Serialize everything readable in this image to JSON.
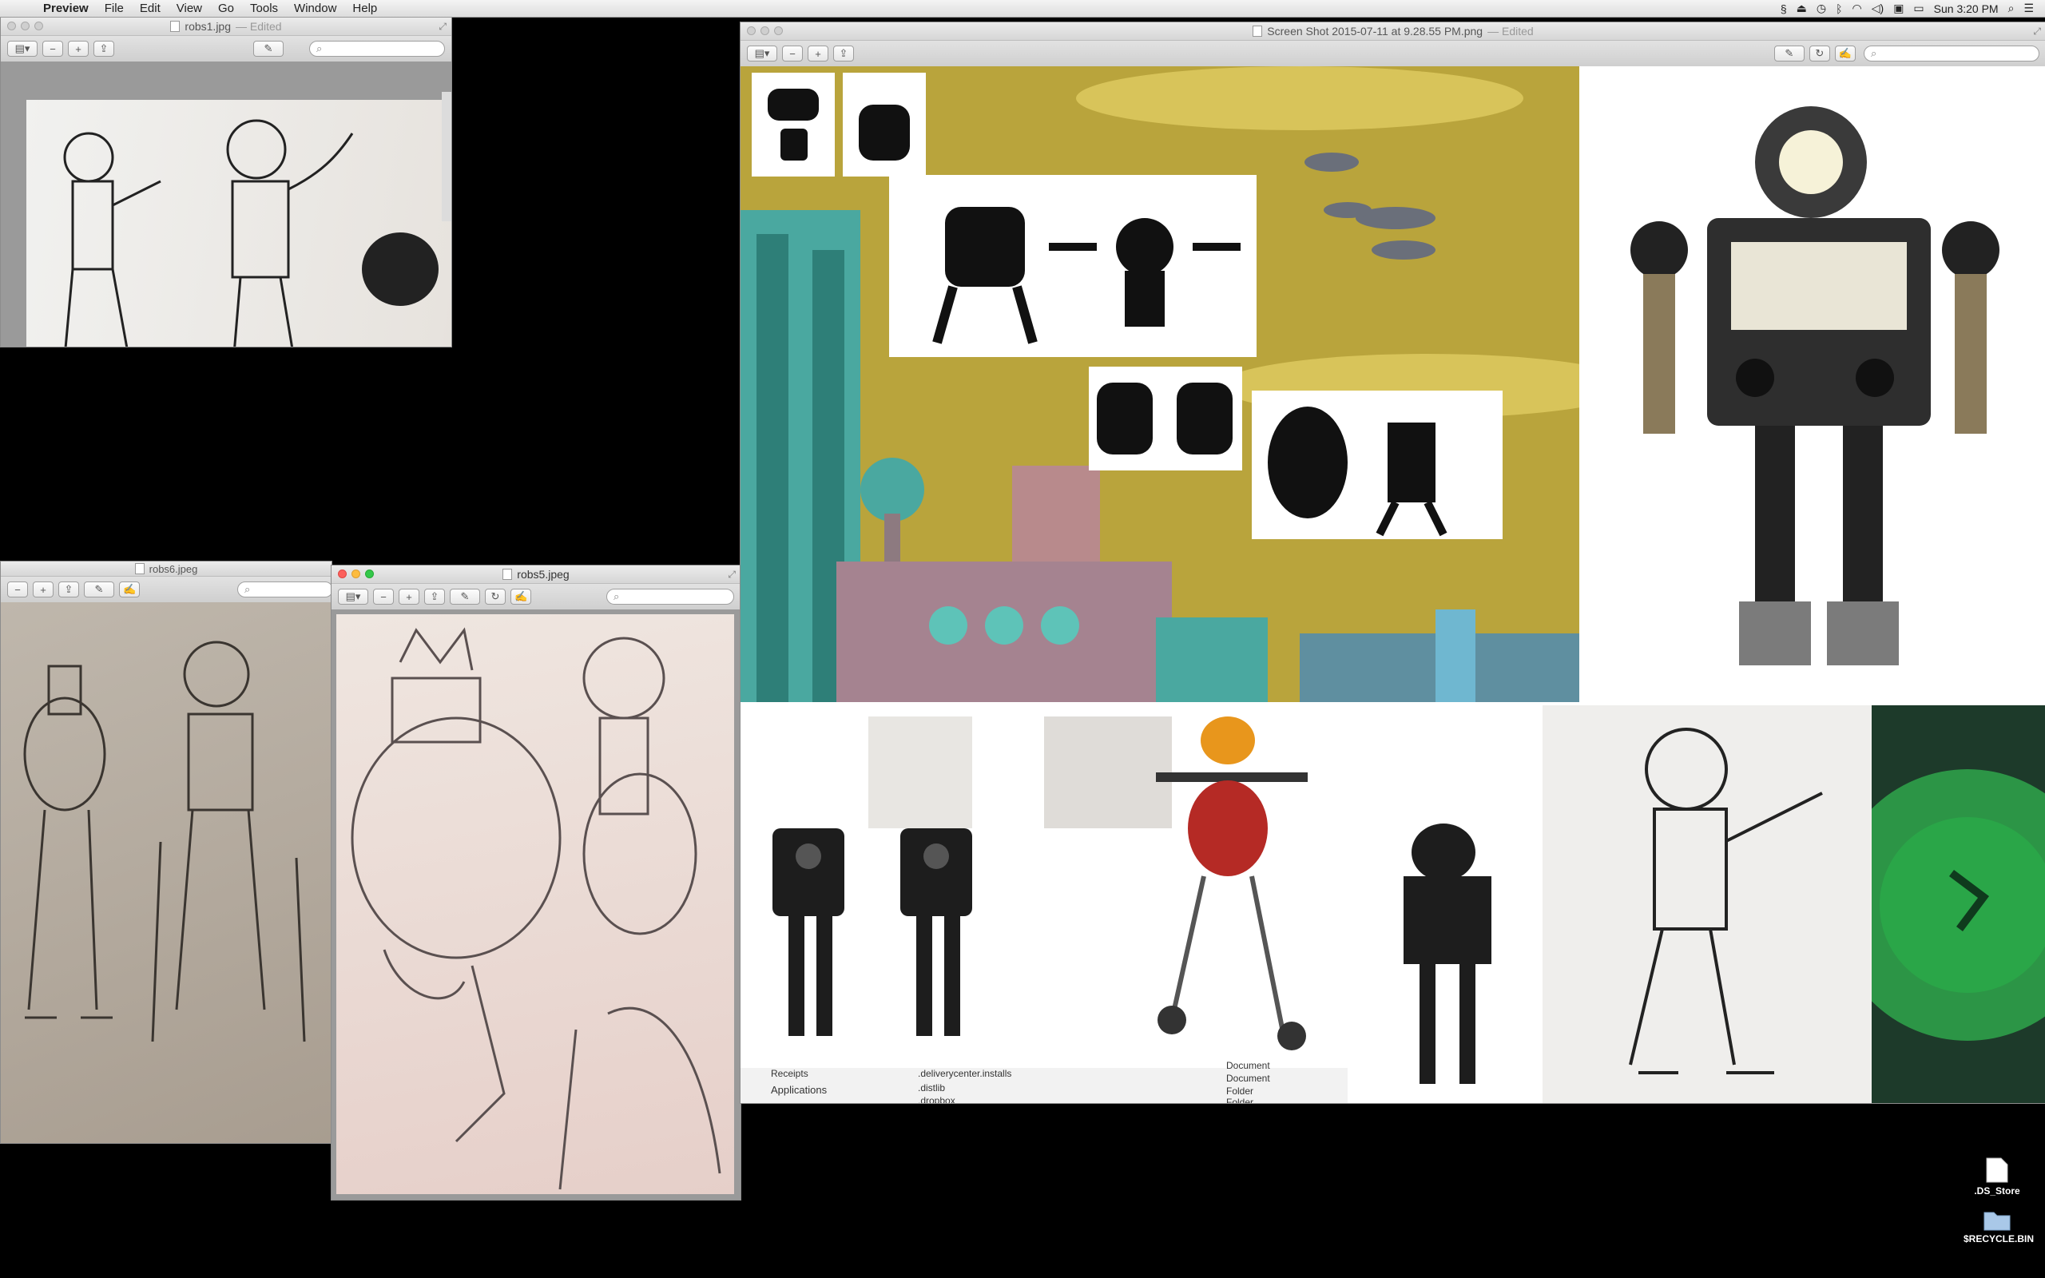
{
  "menubar": {
    "app_name": "Preview",
    "items": [
      "File",
      "Edit",
      "View",
      "Go",
      "Tools",
      "Window",
      "Help"
    ],
    "clock": "Sun 3:20 PM",
    "status_icons": [
      "script-icon",
      "eject-icon",
      "time-machine-icon",
      "bluetooth-icon",
      "wifi-icon",
      "volume-icon",
      "input-menu-icon",
      "battery-icon"
    ]
  },
  "windows": {
    "robs1": {
      "title": "robs1.jpg",
      "edited": "— Edited"
    },
    "screenshot": {
      "title": "Screen Shot 2015-07-11 at 9.28.55 PM.png",
      "edited": "— Edited"
    },
    "robs6": {
      "title": "robs6.jpeg"
    },
    "robs5": {
      "title": "robs5.jpeg"
    }
  },
  "toolbar": {
    "sidebar_icon": "sidebar-icon",
    "zoom_out": "−",
    "zoom_in": "+",
    "share": "⇪",
    "annotate": "✎",
    "rotate": "↻",
    "markup": "✍",
    "search_glyph": "⌕"
  },
  "finder_strip": {
    "sidebar_items": [
      "Receipts",
      "Applications"
    ],
    "rows": [
      {
        "name": ".deliverycenter.installs",
        "kind": "Document"
      },
      {
        "name": ".distlib",
        "kind": "Folder"
      },
      {
        "name": ".dropbox",
        "kind": "Folder"
      }
    ]
  },
  "desktop": {
    "icons": [
      {
        "label": ".DS_Store",
        "icon": "document-icon"
      },
      {
        "label": "$RECYCLE.BIN",
        "icon": "folder-icon"
      }
    ]
  },
  "colors": {
    "sky": "#b9a43c",
    "cloud": "#d8c45a",
    "city_teal": "#4aa8a0",
    "green_glow": "#39e05c",
    "paper": "#e9e3dc"
  }
}
